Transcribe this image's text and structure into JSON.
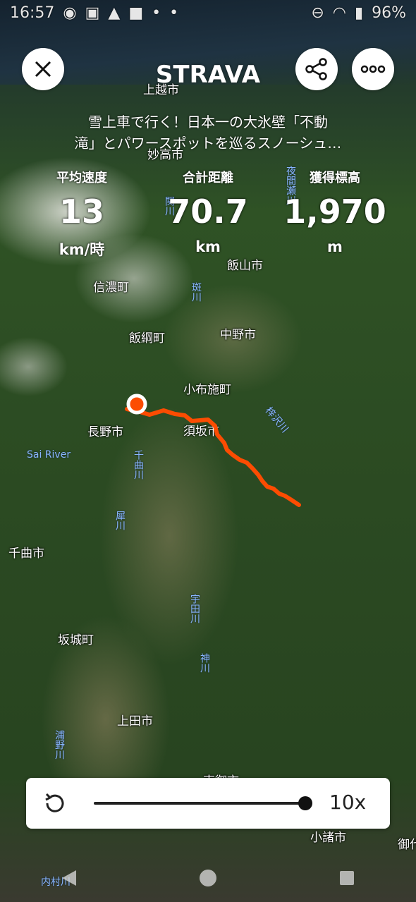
{
  "status_bar": {
    "time": "16:57",
    "battery": "96%",
    "icons": [
      "messenger-icon",
      "app-icon",
      "warning-icon",
      "square-icon",
      "dot",
      "dot",
      "dnd-icon",
      "wifi-icon",
      "battery-icon"
    ]
  },
  "header": {
    "logo": "STRAVA",
    "close_icon": "close-icon",
    "share_icon": "share-icon",
    "more_icon": "more-icon"
  },
  "activity": {
    "title_line1": "雪上車で行く！日本一の大氷壁「不動",
    "title_line2": "滝」とパワースポットを巡るスノーシュ…"
  },
  "stats": {
    "avg_speed": {
      "label": "平均速度",
      "value": "13",
      "unit": "km/時"
    },
    "distance": {
      "label": "合計距離",
      "value": "70.7",
      "unit": "km"
    },
    "elevation": {
      "label": "獲得標高",
      "value": "1,970",
      "unit": "m"
    }
  },
  "map_labels": {
    "joetsu": "上越市",
    "myoko": "妙高市",
    "iiyama": "飯山市",
    "shinano": "信濃町",
    "iizuna": "飯綱町",
    "nakano": "中野市",
    "obuse": "小布施町",
    "nagano": "長野市",
    "suzaka": "須坂市",
    "chikuma": "千曲市",
    "sakaki": "坂城町",
    "ueda": "上田市",
    "tomi": "東御市",
    "komoro": "小諸市",
    "mita": "御代"
  },
  "river_labels": {
    "sai_river": "Sai River",
    "chikumagawa": "千曲川",
    "hiruma": "斑川",
    "yomase": "夜間瀬川",
    "sekikawa": "関川",
    "yasawa": "梓沢川",
    "sanpo": "浦野川",
    "dogawa": "犀川",
    "amagawa": "神川",
    "urano": "内村川",
    "udagawa": "宇田川"
  },
  "playback": {
    "replay_icon": "replay-icon",
    "speed": "10x",
    "progress": 1.0
  },
  "nav_bar": {
    "back_icon": "back-icon",
    "home_icon": "home-icon",
    "recents_icon": "recents-icon"
  },
  "colors": {
    "route": "#fc4c02",
    "start_marker": "#fc4c02",
    "button_bg": "#ffffff"
  }
}
